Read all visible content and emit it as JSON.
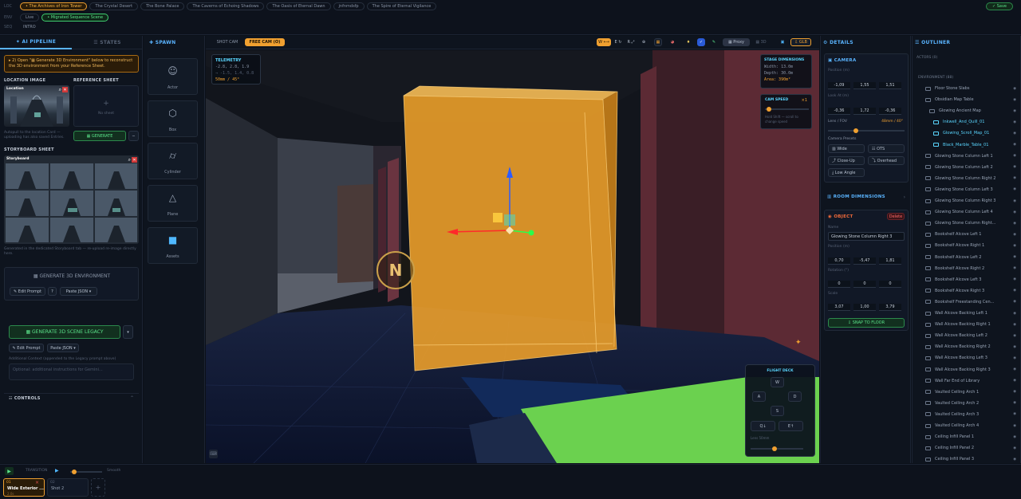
{
  "topbar": {
    "loc_label": "LOC",
    "env_label": "ENV",
    "seq_label": "SEQ",
    "loc_tabs": [
      "• The Archives of Iron Tower",
      "The Crystal Desert",
      "The Bone Palace",
      "The Caverns of Echoing Shadows",
      "The Oasis of Eternal Dawn",
      "jnfnmdsfp",
      "The Spire of Eternal Vigilance"
    ],
    "env_tabs": [
      "Live",
      "• Migrated Sequence Scene"
    ],
    "seq_tab": "INTRO",
    "save": "✓ Save"
  },
  "left": {
    "tab_pipeline": "✦ AI PIPELINE",
    "tab_states": "☰ STATES",
    "notice": "▸ 2) Open \"▦ Generate 3D Environment\" below to reconstruct the 3D environment from your Reference Sheet.",
    "location_image": "LOCATION IMAGE",
    "location_card_title": "Location",
    "reference_sheet": "REFERENCE SHEET",
    "no_sheet": "No sheet",
    "autopull": "Autopull to the location Card — uploading has also saved Entries.",
    "generate": "▦ GENERATE",
    "storyboard_sheet": "STORYBOARD SHEET",
    "storyboard_card_title": "Storyboard",
    "storyboard_hint": "Generated in the dedicated Storyboard tab — re-upload re-image directly here.",
    "gen3d": "▦ GENERATE 3D ENVIRONMENT",
    "edit_prompt": "✎ Edit Prompt",
    "info": "?",
    "paste_json": "Paste JSON ▾",
    "gen_legacy": "▦ GENERATE 3D SCENE LEGACY",
    "dropdown": "▾",
    "edit_prompt2": "✎ Edit Prompt",
    "paste_json2": "Paste JSON ▾",
    "additional_context": "Additional Context (appended to the Legacy prompt above)",
    "textarea_placeholder": "Optional: additional instructions for Gemini...",
    "controls": "☷ CONTROLS"
  },
  "spawn": {
    "title": "✚ SPAWN",
    "items": [
      {
        "label": "Actor",
        "icon": "person-icon"
      },
      {
        "label": "Box",
        "icon": "cube-icon"
      },
      {
        "label": "Cylinder",
        "icon": "cylinder-icon"
      },
      {
        "label": "Plane",
        "icon": "triangle-icon"
      },
      {
        "label": "Assets",
        "icon": "asset-cube-icon"
      }
    ]
  },
  "viewport": {
    "shot_cam": "SHOT CAM",
    "free_cam": "FREE CAM (O)",
    "tools": [
      "W ⟷",
      "E ↻",
      "R ⤢",
      "⊕"
    ],
    "proxy": "▦ Proxy",
    "three_d": "▦ 3D",
    "glb": "⇩ GLB",
    "telemetry": {
      "title": "TELEMETRY",
      "line1": "-2.8, 2.8, 1.9",
      "line2": "→ -1.5, 1.4, 0.8",
      "line3": "50mm / 45°"
    },
    "stage": {
      "title": "STAGE DIMENSIONS",
      "width": "Width: 13.0m",
      "depth": "Depth: 30.0m",
      "area": "Area: 390m²"
    },
    "cam_speed": {
      "title": "CAM SPEED",
      "value": "×1",
      "hint": "Hold Shift — scroll to change speed",
      "level": 0.05
    },
    "compass": "N",
    "flight": {
      "title": "FLIGHT DECK",
      "keys": [
        "W",
        "A",
        "D",
        "S",
        "Q↓",
        "E↑"
      ],
      "lens_label": "Lens 50mm",
      "lens_level": 0.45
    }
  },
  "details": {
    "title": "⚙ DETAILS",
    "camera": {
      "title": "▣ CAMERA",
      "position_label": "Position (m)",
      "position": [
        "-1,09",
        "1,55",
        "1,51"
      ],
      "lookat_label": "Look At (m)",
      "lookat": [
        "-0,36",
        "1,72",
        "-0,36"
      ],
      "lens_label": "Lens / FOV",
      "lens_value": "48mm / 40°",
      "lens_level": 0.35,
      "presets_label": "Camera Presets",
      "presets": [
        "▥ Wide",
        "☷ OTS",
        "⤴ Close-Up",
        "⤵ Overhead",
        "⤓ Low Angle"
      ]
    },
    "room_dimensions": "▥ ROOM DIMENSIONS",
    "object": {
      "title": "◉ OBJECT",
      "delete": "Delete",
      "name_label": "Name",
      "name": "Glowing Stone Column Right 3",
      "position_label": "Position (m)",
      "position": [
        "0,70",
        "-5,47",
        "1,81"
      ],
      "rotation_label": "Rotation (°)",
      "rotation": [
        "0",
        "0",
        "0"
      ],
      "scale_label": "Scale",
      "scale": [
        "3,07",
        "1,00",
        "3,79"
      ],
      "snap": "⇩ SNAP TO FLOOR"
    }
  },
  "outliner": {
    "title": "☰ OUTLINER",
    "actors": "ACTORS (0)",
    "environment": "ENVIRONMENT (88)",
    "items": [
      {
        "label": "Floor Stone Slabs",
        "indent": 0,
        "sel": false
      },
      {
        "label": "Obsidian Map Table",
        "indent": 0,
        "sel": false
      },
      {
        "label": "Glowing Ancient Map",
        "indent": 1,
        "sel": false
      },
      {
        "label": "Inkwell_And_Quill_01",
        "indent": 2,
        "sel": true
      },
      {
        "label": "Glowing_Scroll_Map_01",
        "indent": 2,
        "sel": true
      },
      {
        "label": "Black_Marble_Table_01",
        "indent": 2,
        "sel": true
      },
      {
        "label": "Glowing Stone Column Left 1",
        "indent": 0,
        "sel": false
      },
      {
        "label": "Glowing Stone Column Left 2",
        "indent": 0,
        "sel": false
      },
      {
        "label": "Glowing Stone Column Right 2",
        "indent": 0,
        "sel": false
      },
      {
        "label": "Glowing Stone Column Left 3",
        "indent": 0,
        "sel": false
      },
      {
        "label": "Glowing Stone Column Right 3",
        "indent": 0,
        "sel": false
      },
      {
        "label": "Glowing Stone Column Left 4",
        "indent": 0,
        "sel": false
      },
      {
        "label": "Glowing Stone Column Right...",
        "indent": 0,
        "sel": false
      },
      {
        "label": "Bookshelf Alcove Left 1",
        "indent": 0,
        "sel": false
      },
      {
        "label": "Bookshelf Alcove Right 1",
        "indent": 0,
        "sel": false
      },
      {
        "label": "Bookshelf Alcove Left 2",
        "indent": 0,
        "sel": false
      },
      {
        "label": "Bookshelf Alcove Right 2",
        "indent": 0,
        "sel": false
      },
      {
        "label": "Bookshelf Alcove Left 3",
        "indent": 0,
        "sel": false
      },
      {
        "label": "Bookshelf Alcove Right 3",
        "indent": 0,
        "sel": false
      },
      {
        "label": "Bookshelf Freestanding Cen...",
        "indent": 0,
        "sel": false
      },
      {
        "label": "Wall Alcove Backing Left 1",
        "indent": 0,
        "sel": false
      },
      {
        "label": "Wall Alcove Backing Right 1",
        "indent": 0,
        "sel": false
      },
      {
        "label": "Wall Alcove Backing Left 2",
        "indent": 0,
        "sel": false
      },
      {
        "label": "Wall Alcove Backing Right 2",
        "indent": 0,
        "sel": false
      },
      {
        "label": "Wall Alcove Backing Left 3",
        "indent": 0,
        "sel": false
      },
      {
        "label": "Wall Alcove Backing Right 3",
        "indent": 0,
        "sel": false
      },
      {
        "label": "Wall Far End of Library",
        "indent": 0,
        "sel": false
      },
      {
        "label": "Vaulted Ceiling Arch 1",
        "indent": 0,
        "sel": false
      },
      {
        "label": "Vaulted Ceiling Arch 2",
        "indent": 0,
        "sel": false
      },
      {
        "label": "Vaulted Ceiling Arch 3",
        "indent": 0,
        "sel": false
      },
      {
        "label": "Vaulted Ceiling Arch 4",
        "indent": 0,
        "sel": false
      },
      {
        "label": "Ceiling Infill Panel 1",
        "indent": 0,
        "sel": false
      },
      {
        "label": "Ceiling Infill Panel 2",
        "indent": 0,
        "sel": false
      },
      {
        "label": "Ceiling Infill Panel 3",
        "indent": 0,
        "sel": false
      }
    ]
  },
  "timeline": {
    "play": "▶",
    "transition_label": "TRANSITION",
    "transition_play": "▶",
    "smooth": "Smooth",
    "transition_level": 0.05,
    "shots": [
      {
        "num": "01",
        "name": "Wide Exterior ...",
        "meta": "2.0s",
        "active": true
      },
      {
        "num": "02",
        "name": "Shot 2",
        "meta": "",
        "active": false
      }
    ],
    "add": "+"
  }
}
